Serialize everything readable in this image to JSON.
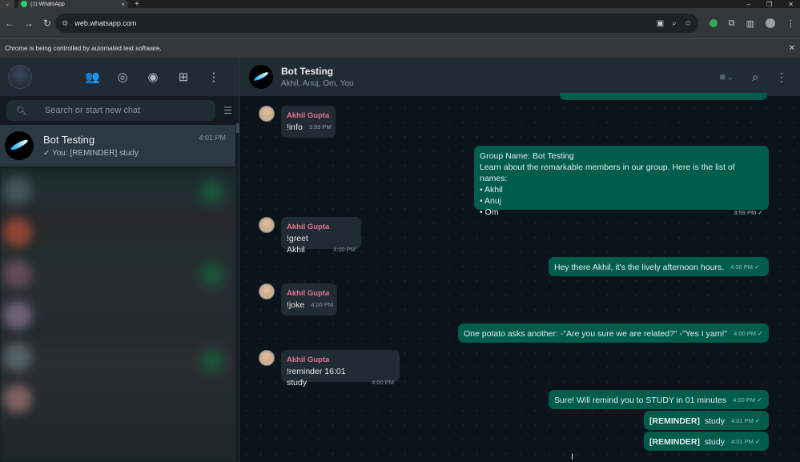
{
  "browser": {
    "tab_title": "(1) WhatsApp",
    "url": "web.whatsapp.com",
    "automation_notice": "Chrome is being controlled by automated test software."
  },
  "sidebar": {
    "search_placeholder": "Search or start new chat",
    "active_chat": {
      "name": "Bot Testing",
      "time": "4:01 PM",
      "preview": "✓ You: [REMINDER]  study"
    }
  },
  "conversation": {
    "name": "Bot Testing",
    "members": "Akhil, Anuj, Om, You",
    "messages": [
      {
        "dir": "in",
        "sender": "Akhil Gupta",
        "text": "!info",
        "time": "3:59 PM"
      },
      {
        "dir": "out",
        "lines": [
          "Group Name: Bot Testing",
          "Learn about the remarkable members in our group. Here is the list of names:",
          "• Akhil",
          "• Anuj",
          "• Om"
        ],
        "time": "3:59 PM"
      },
      {
        "dir": "in",
        "sender": "Akhil Gupta",
        "text": "!greet Akhil",
        "time": "4:00 PM"
      },
      {
        "dir": "out",
        "text": "Hey there Akhil, it's the lively afternoon hours.",
        "time": "4:00 PM"
      },
      {
        "dir": "in",
        "sender": "Akhil Gupta",
        "text": "!joke",
        "time": "4:00 PM"
      },
      {
        "dir": "out",
        "text": "One potato asks another: -\"Are you sure we are related?\" -\"Yes I yam!\"",
        "time": "4:00 PM"
      },
      {
        "dir": "in",
        "sender": "Akhil Gupta",
        "text": "!reminder 16:01 study",
        "time": "4:00 PM"
      },
      {
        "dir": "out",
        "text": "Sure! Will remind you to STUDY in 01 minutes",
        "time": "4:00 PM"
      },
      {
        "dir": "out",
        "bold": "[REMINDER]",
        "text": "study",
        "time": "4:01 PM"
      },
      {
        "dir": "out",
        "bold": "[REMINDER]",
        "text": "study",
        "time": "4:01 PM"
      }
    ]
  },
  "icons": [
    "community-icon",
    "status-icon",
    "channels-icon",
    "new-chat-icon",
    "menu-icon",
    "search-icon",
    "filter-icon",
    "video-call-icon",
    "read-tick-icon"
  ],
  "colors": {
    "accent_out": "#005c4b",
    "bubble_in": "#202c33",
    "panel": "#202c33",
    "background": "#0b141a",
    "sender_name": "#e27396"
  }
}
